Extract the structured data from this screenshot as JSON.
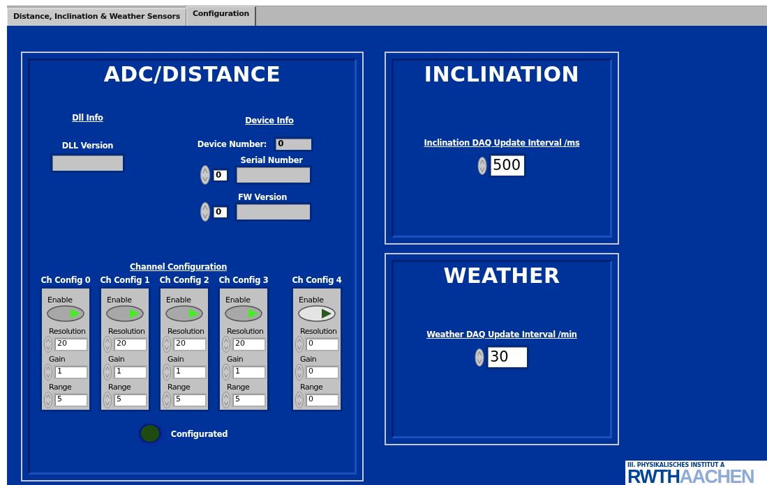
{
  "tabs": [
    {
      "label": "Distance, Inclination & Weather Sensors",
      "selected": false
    },
    {
      "label": "Configuration",
      "selected": true
    }
  ],
  "adc_panel": {
    "title": "ADC/DISTANCE",
    "dll_info": {
      "heading": "Dll Info",
      "dll_version": {
        "label": "DLL Version"
      }
    },
    "device_info": {
      "heading": "Device Info",
      "device_number": {
        "label": "Device Number:",
        "value": "0"
      },
      "serial_number": {
        "label": "Serial Number",
        "index": "0"
      },
      "fw_version": {
        "label": "FW Version",
        "index": "0"
      }
    },
    "channel_configuration": {
      "heading": "Channel Configuration",
      "channels": [
        {
          "title": "Ch Config 0",
          "enable_label": "Enable",
          "enabled": true,
          "fields": [
            {
              "label": "Resolution",
              "value": "20"
            },
            {
              "label": "Gain",
              "value": "1"
            },
            {
              "label": "Range",
              "value": "5"
            }
          ]
        },
        {
          "title": "Ch Config 1",
          "enable_label": "Enable",
          "enabled": true,
          "fields": [
            {
              "label": "Resolution",
              "value": "20"
            },
            {
              "label": "Gain",
              "value": "1"
            },
            {
              "label": "Range",
              "value": "5"
            }
          ]
        },
        {
          "title": "Ch Config 2",
          "enable_label": "Enable",
          "enabled": true,
          "fields": [
            {
              "label": "Resolution",
              "value": "20"
            },
            {
              "label": "Gain",
              "value": "1"
            },
            {
              "label": "Range",
              "value": "5"
            }
          ]
        },
        {
          "title": "Ch Config 3",
          "enable_label": "Enable",
          "enabled": true,
          "fields": [
            {
              "label": "Resolution",
              "value": "20"
            },
            {
              "label": "Gain",
              "value": "1"
            },
            {
              "label": "Range",
              "value": "5"
            }
          ]
        },
        {
          "title": "Ch Config 4",
          "enable_label": "Enable",
          "enabled": false,
          "fields": [
            {
              "label": "Resolution",
              "value": "0"
            },
            {
              "label": "Gain",
              "value": "0"
            },
            {
              "label": "Range",
              "value": "0"
            }
          ]
        }
      ]
    },
    "configurated": {
      "label": "Configurated",
      "on": false
    }
  },
  "inclination_panel": {
    "title": "INCLINATION",
    "interval": {
      "label": "Inclination DAQ Update Interval /ms",
      "value": "500"
    }
  },
  "weather_panel": {
    "title": "WEATHER",
    "interval": {
      "label": "Weather DAQ Update Interval /min",
      "value": "30"
    }
  },
  "logo": {
    "institute": "III. PHYSIKALISCHES INSTITUT A",
    "left_word": "RWTH",
    "right_word": "AACHEN"
  }
}
